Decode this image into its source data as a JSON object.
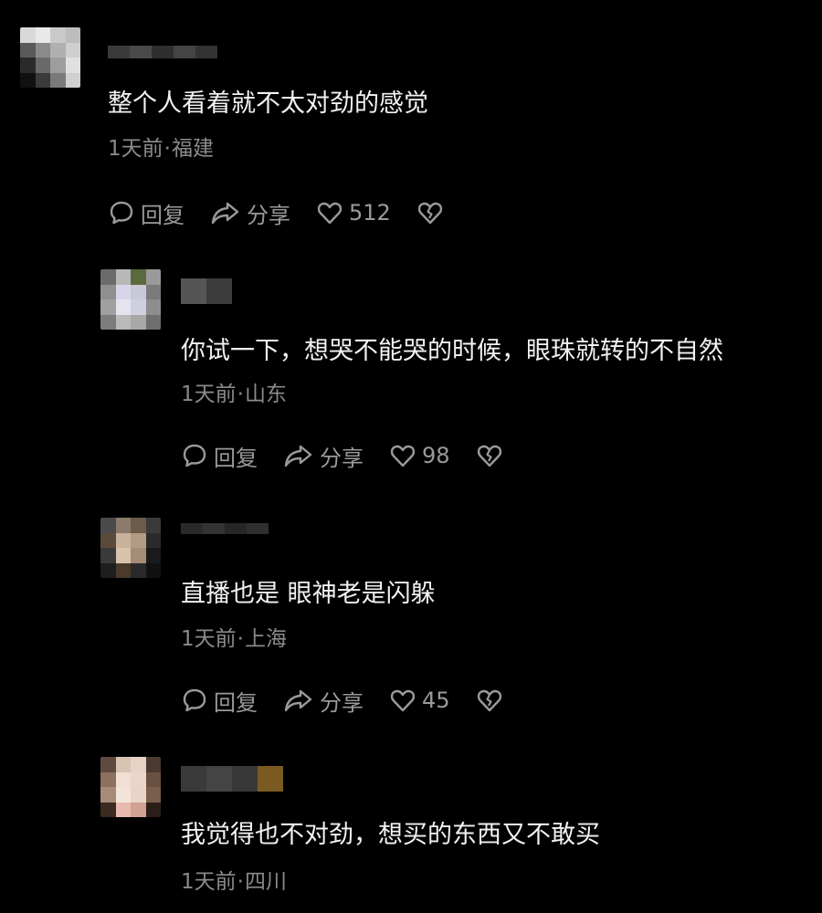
{
  "colors": {
    "background": "#000000",
    "text": "#f2f2f2",
    "meta": "#8a8a8a",
    "action": "#9a9a9a"
  },
  "actions": {
    "reply_label": "回复",
    "share_label": "分享"
  },
  "icons": {
    "reply": "comment-bubble-icon",
    "share": "share-arrow-icon",
    "like": "heart-outline-icon",
    "dislike": "broken-heart-icon"
  },
  "comments": [
    {
      "text": "整个人看着就不太对劲的感觉",
      "time": "1天前",
      "separator": "·",
      "location": "福建",
      "likes": "512",
      "is_reply": false
    },
    {
      "text": "你试一下，想哭不能哭的时候，眼珠就转的不自然",
      "time": "1天前",
      "separator": "·",
      "location": "山东",
      "likes": "98",
      "is_reply": true
    },
    {
      "text": "直播也是 眼神老是闪躲",
      "time": "1天前",
      "separator": "·",
      "location": "上海",
      "likes": "45",
      "is_reply": true
    },
    {
      "text": "我觉得也不对劲，想买的东西又不敢买",
      "time": "1天前",
      "separator": "·",
      "location": "四川",
      "is_reply": true
    }
  ]
}
